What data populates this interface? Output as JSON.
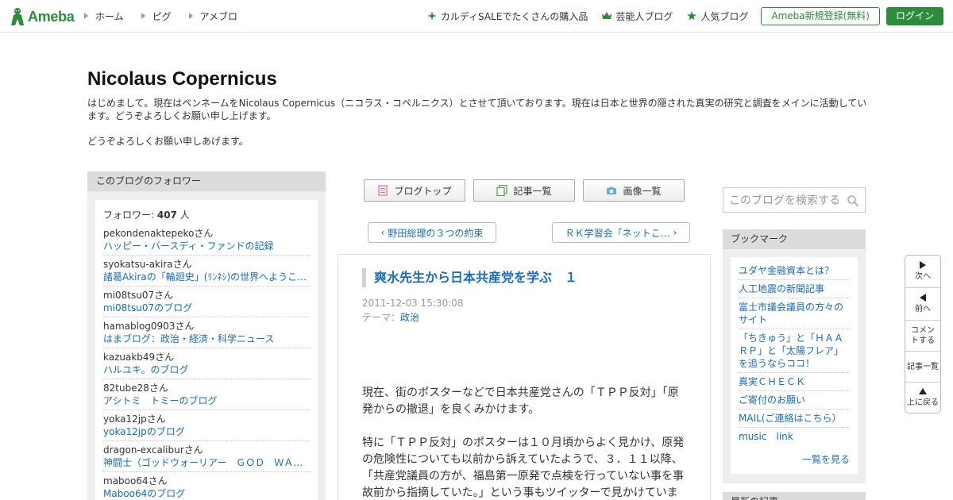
{
  "header": {
    "logo_text": "Ameba",
    "nav": [
      "ホーム",
      "ピグ",
      "アメブロ"
    ],
    "promo": [
      {
        "label": "カルディSALEでたくさんの購入品",
        "icon": "sparkle-icon"
      },
      {
        "label": "芸能人ブログ",
        "icon": "crown-icon"
      },
      {
        "label": "人気ブログ",
        "icon": "star-icon"
      }
    ],
    "register_label": "Ameba新規登録(無料)",
    "login_label": "ログイン",
    "accent_color": "#2d8c3c"
  },
  "blog": {
    "title": "Nicolaus Copernicus",
    "description_1": "はじめまして。現在はペンネームをNicolaus Copernicus（ニコラス・コペルニクス）とさせて頂いております。現在は日本と世界の隠された真実の研究と調査をメインに活動しています。どうぞよろしくお願い申し上げます。",
    "description_2": "どうぞよろしくお願い申しあげます。"
  },
  "followers": {
    "heading": "このブログのフォロワー",
    "count_label": "フォロワー: ",
    "count": "407",
    "count_unit": " 人",
    "items": [
      {
        "name": "pekondenaktepekoさん",
        "blog": "ハッピー・バースディ・ファンドの記録"
      },
      {
        "name": "syokatsu-akiraさん",
        "blog": "諸葛Akiraの「輪廻史」(ﾘﾝﾈｼ)の世界へようこそ!"
      },
      {
        "name": "mi08tsu07さん",
        "blog": "mi08tsu07のブログ"
      },
      {
        "name": "hamablog0903さん",
        "blog": "はまブログ：政治・経済・科学ニュース"
      },
      {
        "name": "kazuakb49さん",
        "blog": "ハルユキ。のブログ"
      },
      {
        "name": "82tube28さん",
        "blog": "アシトミ　トミーのブログ"
      },
      {
        "name": "yoka12jpさん",
        "blog": "yoka12jpのブログ"
      },
      {
        "name": "dragon-excaliburさん",
        "blog": "神闘士（ゴッドウォーリアー　ＧＯＤ　ＷＡＲＲＩＯＲ）"
      },
      {
        "name": "maboo64さん",
        "blog": "Maboo64のブログ"
      }
    ]
  },
  "toolbar": {
    "blog_top": "ブログトップ",
    "entry_list": "記事一覧",
    "image_list": "画像一覧"
  },
  "pager": {
    "prev": "野田総理の３つの約束",
    "next": "ＲＫ学習会「ネットこ…"
  },
  "article": {
    "title": "爽水先生から日本共産党を学ぶ　１",
    "date": "2011-12-03 15:30:08",
    "theme_label": "テーマ：",
    "theme": "政治",
    "paragraph_1": "現在、街のポスターなどで日本共産党さんの「ＴＰＰ反対」「原発からの撤退」を良くみかけます。",
    "paragraph_2": "特に「ＴＰＰ反対」のポスターは１０月頃からよく見かけ、原発の危険性についても以前から訴えていたようで、３．１１以降、「共産党議員の方が、福島第一原発で点検を行っていない事を事故前から指摘していた。」という事もツイッターで見かけていま"
  },
  "search": {
    "placeholder": "このブログを検索する"
  },
  "bookmarks": {
    "heading": "ブックマーク",
    "items": [
      "ユダヤ金融資本とは？",
      "人工地震の新聞記事",
      "富士市議会議員の方々のサイト",
      "「ちきゅう」と「ＨＡＡＲＰ」と「太陽フレア」を追うならココ！",
      "真実ＣＨＥＣＫ",
      "ご寄付のお願い",
      "MAIL(ご連絡はこちら）",
      "music　link"
    ],
    "more": "一覧を見る"
  },
  "recent": {
    "heading": "最新の記事"
  },
  "sidenav": {
    "next": "次へ",
    "prev": "前へ",
    "comment": "コメントする",
    "entries": "記事一覧",
    "top": "上に戻る"
  }
}
